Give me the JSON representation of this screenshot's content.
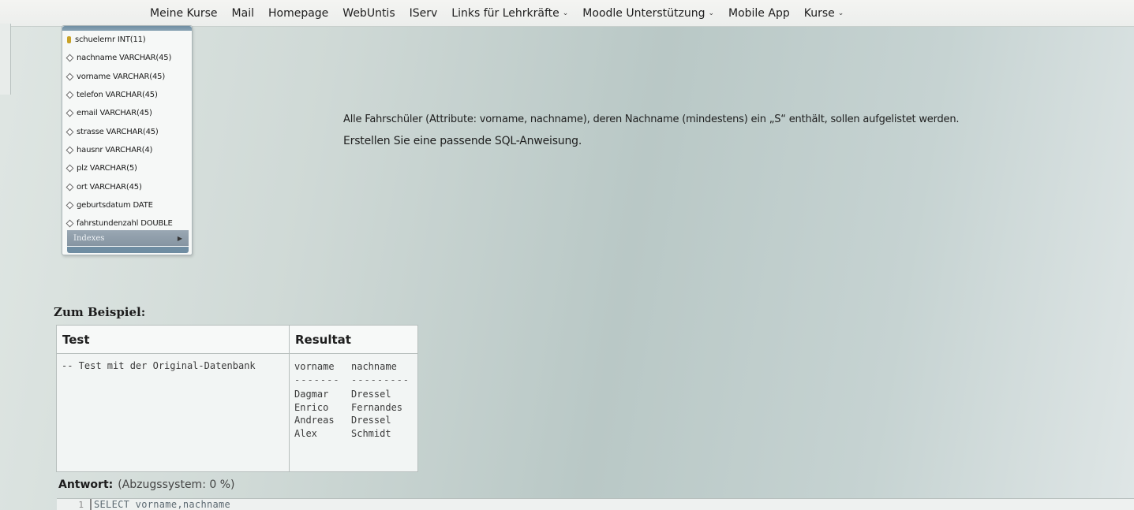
{
  "nav": {
    "items": [
      {
        "label": "Meine Kurse",
        "dropdown": false
      },
      {
        "label": "Mail",
        "dropdown": false
      },
      {
        "label": "Homepage",
        "dropdown": false
      },
      {
        "label": "WebUntis",
        "dropdown": false
      },
      {
        "label": "IServ",
        "dropdown": false
      },
      {
        "label": "Links für Lehrkräfte",
        "dropdown": true
      },
      {
        "label": "Moodle Unterstützung",
        "dropdown": true
      },
      {
        "label": "Mobile App",
        "dropdown": false
      },
      {
        "label": "Kurse",
        "dropdown": true
      }
    ]
  },
  "schema": {
    "columns": [
      {
        "text": "schuelernr INT(11)",
        "icon": "primary-key-icon"
      },
      {
        "text": "nachname VARCHAR(45)",
        "icon": "column-diamond-icon"
      },
      {
        "text": "vorname VARCHAR(45)",
        "icon": "column-diamond-icon"
      },
      {
        "text": "telefon VARCHAR(45)",
        "icon": "column-diamond-icon"
      },
      {
        "text": "email VARCHAR(45)",
        "icon": "column-diamond-icon"
      },
      {
        "text": "strasse VARCHAR(45)",
        "icon": "column-diamond-icon"
      },
      {
        "text": "hausnr VARCHAR(4)",
        "icon": "column-diamond-icon"
      },
      {
        "text": "plz VARCHAR(5)",
        "icon": "column-diamond-icon"
      },
      {
        "text": "ort VARCHAR(45)",
        "icon": "column-diamond-icon"
      },
      {
        "text": "geburtsdatum DATE",
        "icon": "column-diamond-icon"
      },
      {
        "text": "fahrstundenzahl DOUBLE",
        "icon": "column-diamond-icon"
      }
    ],
    "indexes_label": "Indexes"
  },
  "question": {
    "line1": "Alle Fahrschüler (Attribute: vorname, nachname), deren Nachname (mindestens) ein „S“ enthält, sollen aufgelistet werden.",
    "line2": "Erstellen Sie eine passende SQL-Anweisung."
  },
  "example": {
    "title": "Zum Beispiel:",
    "header_test": "Test",
    "header_result": "Resultat",
    "test_text": "-- Test mit der Original-Datenbank",
    "result_columns": [
      "vorname",
      "nachname"
    ],
    "result_separators": [
      "-------",
      "---------"
    ],
    "result_rows": [
      [
        "Dagmar",
        "Dressel"
      ],
      [
        "Enrico",
        "Fernandes"
      ],
      [
        "Andreas",
        "Dressel"
      ],
      [
        "Alex",
        "Schmidt"
      ]
    ]
  },
  "answer": {
    "label": "Antwort:",
    "penalty": "(Abzugssystem: 0 %)",
    "editor_line_number": "1",
    "editor_code": "SELECT vorname,nachname"
  },
  "colors": {
    "accent_header": "#6f8ea3",
    "key_icon": "#c9a227"
  }
}
